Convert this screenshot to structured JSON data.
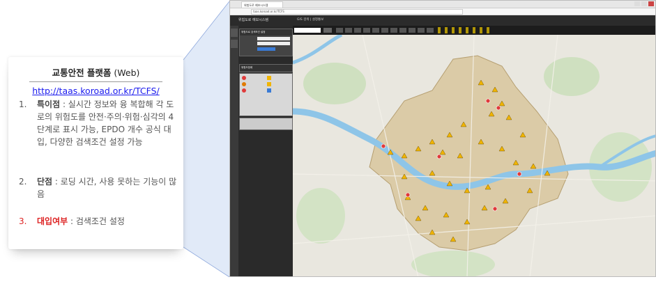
{
  "card": {
    "title_bold": "교통안전 플랫폼",
    "title_suffix": " (Web)",
    "link": "http://taas.koroad.or.kr/TCFS/",
    "items": [
      {
        "num": "1.",
        "label": "특이점",
        "text": " : 실시간 정보와 융 복합해 각 도로의 위험도를 안전·주의·위험·심각의 4단계로 표시 가능, EPDO 개수 공식 대입, 다양한 검색조건 설정 가능"
      },
      {
        "num": "2.",
        "label": "단점",
        "text": " : 로딩 시간, 사용 못하는 기능이 많음"
      },
      {
        "num": "3.",
        "label": "대입여부",
        "text": " : 검색조건 설정"
      }
    ]
  },
  "screenshot": {
    "browser_tab": "위험도로 예보시스템",
    "url": "taas.koroad.or.kr/TCFS",
    "app_title": "위험도로 예보시스템",
    "app_tab": "GIS 검색 | 설정통보",
    "panel_title": "위험도로 검색조건 설정",
    "legend_title": "위험도범례",
    "map": {
      "water_color": "#8ec5e8",
      "land_color": "#e9e7df",
      "seoul_color": "#d8c59a",
      "marker_color": "#f0b400",
      "alert_color": "#e03b3b"
    }
  }
}
